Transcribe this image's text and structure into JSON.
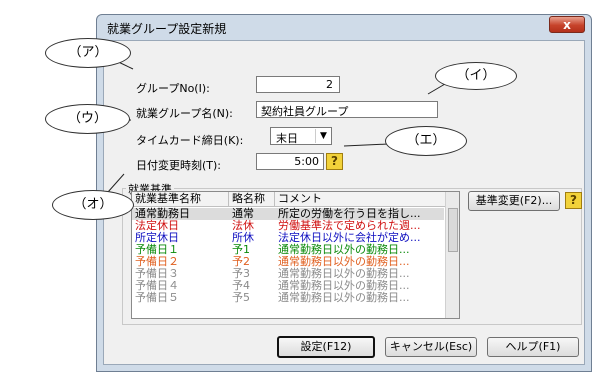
{
  "window": {
    "title": "就業グループ設定新規",
    "close_glyph": "x"
  },
  "form": {
    "group_no_label": "グループNo(I):",
    "group_no_value": "2",
    "group_name_label": "就業グループ名(N):",
    "group_name_value": "契約社員グループ",
    "timecard_label": "タイムカード締日(K):",
    "timecard_value": "末日",
    "date_change_label": "日付変更時刻(T):",
    "date_change_value": "5:00",
    "help_glyph": "?"
  },
  "standards": {
    "group_label": "就業基準",
    "columns": [
      "就業基準名称",
      "略名称",
      "コメント"
    ],
    "rows": [
      {
        "name": "通常勤務日",
        "abbr": "通常",
        "comment": "所定の労働を行う日を指し...",
        "color": "#000000",
        "selected": true
      },
      {
        "name": "法定休日",
        "abbr": "法休",
        "comment": "労働基準法で定められた週...",
        "color": "#d01010",
        "selected": false
      },
      {
        "name": "所定休日",
        "abbr": "所休",
        "comment": "法定休日以外に会社が定め...",
        "color": "#1010c0",
        "selected": false
      },
      {
        "name": "予備日１",
        "abbr": "予1",
        "comment": "通常勤務日以外の勤務日...",
        "color": "#0a8a0a",
        "selected": false
      },
      {
        "name": "予備日２",
        "abbr": "予2",
        "comment": "通常勤務日以外の勤務日...",
        "color": "#e06020",
        "selected": false
      },
      {
        "name": "予備日３",
        "abbr": "予3",
        "comment": "通常勤務日以外の勤務日...",
        "color": "#8a8a8a",
        "selected": false
      },
      {
        "name": "予備日４",
        "abbr": "予4",
        "comment": "通常勤務日以外の勤務日...",
        "color": "#8a8a8a",
        "selected": false
      },
      {
        "name": "予備日５",
        "abbr": "予5",
        "comment": "通常勤務日以外の勤務日...",
        "color": "#8a8a8a",
        "selected": false
      }
    ],
    "change_button": "基準変更(F2)..."
  },
  "buttons": {
    "ok": "設定(F12)",
    "cancel": "キャンセル(Esc)",
    "help": "ヘルプ(F1)"
  },
  "callouts": {
    "a": "（ア）",
    "b": "（イ）",
    "c": "（ウ）",
    "d": "（エ）",
    "e": "（オ）"
  },
  "colors": {
    "title_bar": "#cfdbe8",
    "close_button": "#c7432b",
    "help_icon": "#f2d23a",
    "selection": "#dcdcdc"
  }
}
